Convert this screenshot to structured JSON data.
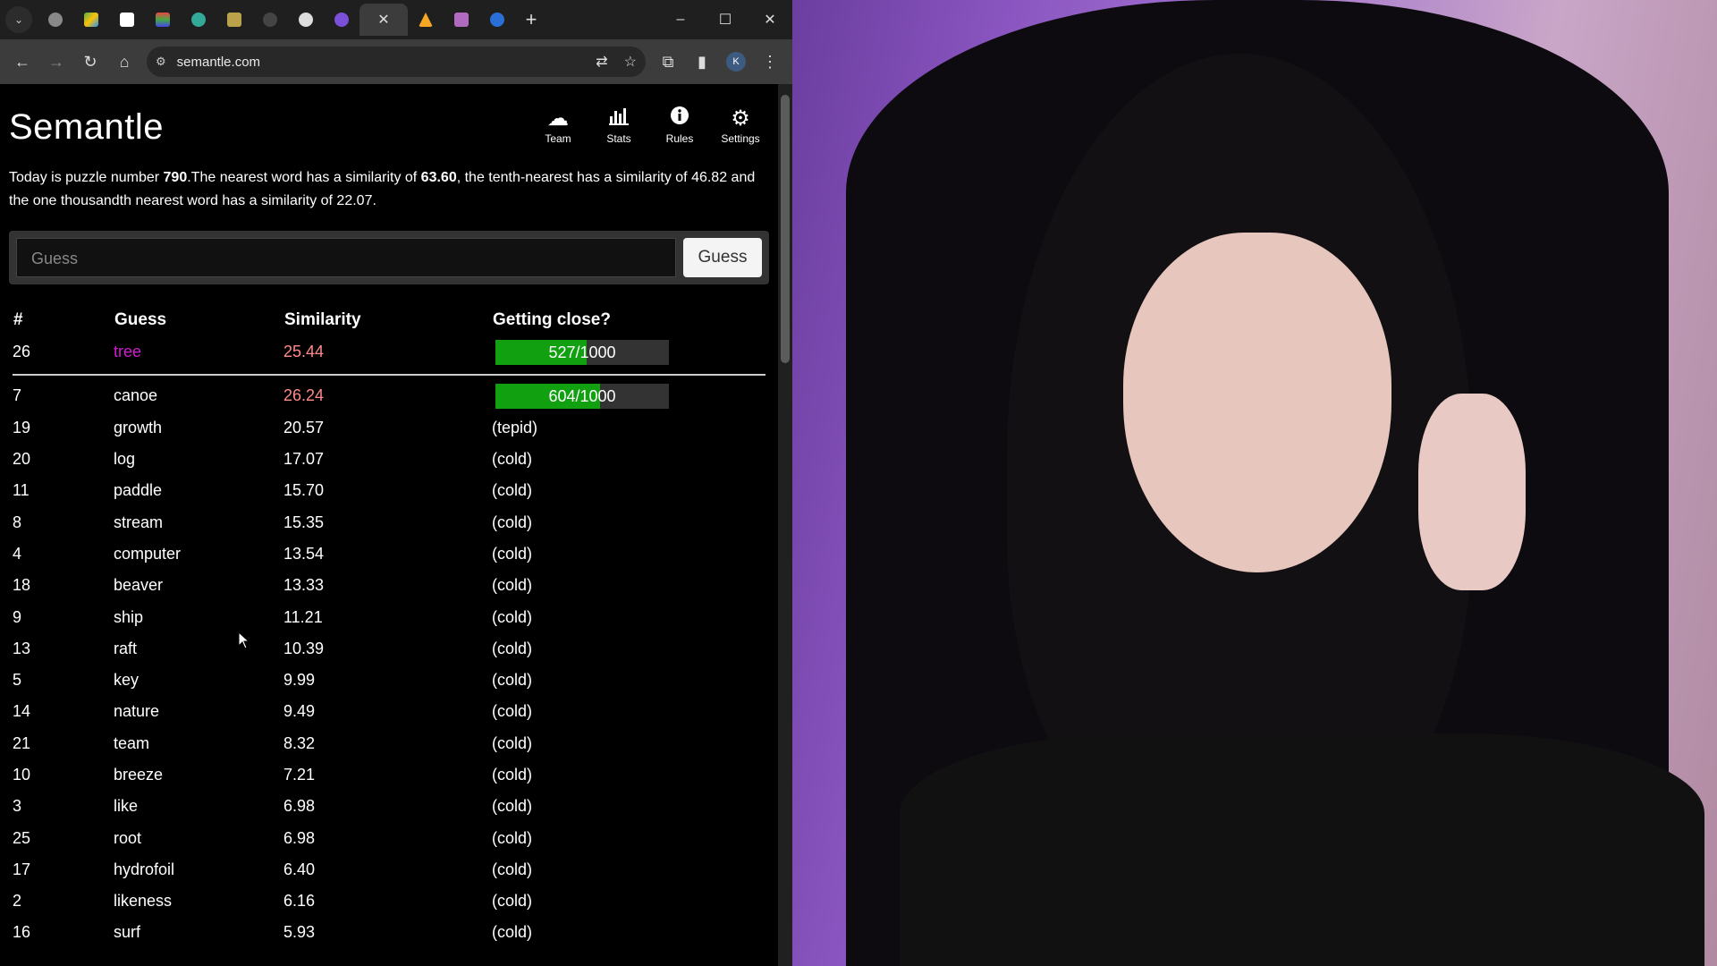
{
  "browser": {
    "url": "semantle.com",
    "tabs_count": 13,
    "profile_initial": "K"
  },
  "app": {
    "title": "Semantle",
    "nav": [
      {
        "label": "Team",
        "icon": "cloud-icon"
      },
      {
        "label": "Stats",
        "icon": "bar-chart-icon"
      },
      {
        "label": "Rules",
        "icon": "info-icon"
      },
      {
        "label": "Settings",
        "icon": "gear-icon"
      }
    ],
    "intro": {
      "p1": "Today is puzzle number ",
      "puzzle": "790",
      "p2": ".The nearest word has a similarity of ",
      "nearest": "63.60",
      "p3": ", the tenth-nearest has a similarity of 46.82 and the one thousandth nearest word has a similarity of 22.07."
    },
    "guess": {
      "placeholder": "Guess",
      "button": "Guess"
    },
    "table": {
      "headers": [
        "#",
        "Guess",
        "Similarity",
        "Getting close?"
      ],
      "latest": {
        "num": "26",
        "word": "tree",
        "sim": "25.44",
        "close": "527/1000",
        "progress": 0.527
      },
      "rows": [
        {
          "num": "7",
          "word": "canoe",
          "sim": "26.24",
          "close": "604/1000",
          "progress": 0.604
        },
        {
          "num": "19",
          "word": "growth",
          "sim": "20.57",
          "close": "(tepid)"
        },
        {
          "num": "20",
          "word": "log",
          "sim": "17.07",
          "close": "(cold)"
        },
        {
          "num": "11",
          "word": "paddle",
          "sim": "15.70",
          "close": "(cold)"
        },
        {
          "num": "8",
          "word": "stream",
          "sim": "15.35",
          "close": "(cold)"
        },
        {
          "num": "4",
          "word": "computer",
          "sim": "13.54",
          "close": "(cold)"
        },
        {
          "num": "18",
          "word": "beaver",
          "sim": "13.33",
          "close": "(cold)"
        },
        {
          "num": "9",
          "word": "ship",
          "sim": "11.21",
          "close": "(cold)"
        },
        {
          "num": "13",
          "word": "raft",
          "sim": "10.39",
          "close": "(cold)"
        },
        {
          "num": "5",
          "word": "key",
          "sim": "9.99",
          "close": "(cold)"
        },
        {
          "num": "14",
          "word": "nature",
          "sim": "9.49",
          "close": "(cold)"
        },
        {
          "num": "21",
          "word": "team",
          "sim": "8.32",
          "close": "(cold)"
        },
        {
          "num": "10",
          "word": "breeze",
          "sim": "7.21",
          "close": "(cold)"
        },
        {
          "num": "3",
          "word": "like",
          "sim": "6.98",
          "close": "(cold)"
        },
        {
          "num": "25",
          "word": "root",
          "sim": "6.98",
          "close": "(cold)"
        },
        {
          "num": "17",
          "word": "hydrofoil",
          "sim": "6.40",
          "close": "(cold)"
        },
        {
          "num": "2",
          "word": "likeness",
          "sim": "6.16",
          "close": "(cold)"
        },
        {
          "num": "16",
          "word": "surf",
          "sim": "5.93",
          "close": "(cold)"
        }
      ]
    }
  },
  "colors": {
    "progress_fill": "#10a010",
    "latest_word": "#d01bd0",
    "warm_similarity": "#ff8a8a"
  }
}
